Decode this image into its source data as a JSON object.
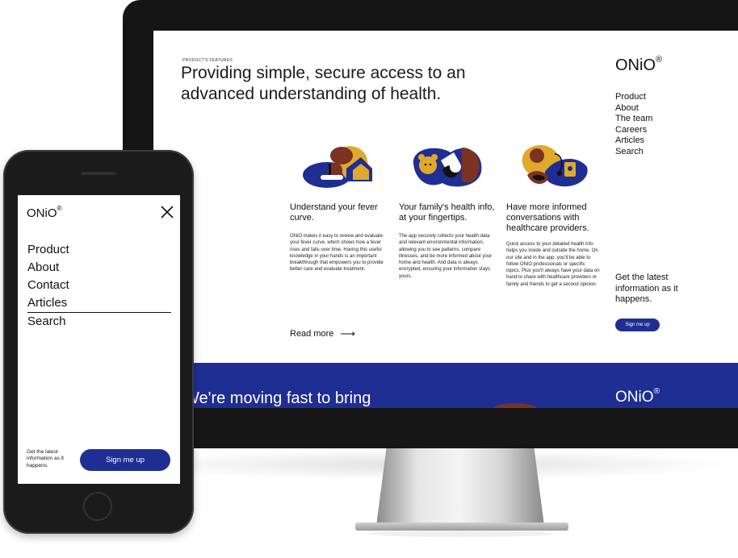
{
  "colors": {
    "brand_blue": "#1f2e93",
    "illustration_yellow": "#e0a92c",
    "illustration_brown": "#7a3323",
    "device_frame": "#151515"
  },
  "desktop": {
    "eyebrow": "PRODUCT'S FEATURES",
    "hero_title": "Providing simple, secure access to an advanced understanding of health.",
    "features": [
      {
        "title": "Understand your fever curve.",
        "body": "ONiO makes it easy to review and evaluate your fever curve, which shows how a fever rises and falls over time. Having this useful knowledge in your hands is an important breakthrough that empowers you to provide better care and evaluate treatment.",
        "illustration_icon": "child-with-thermometer-illustration"
      },
      {
        "title": "Your family's health info, at your fingertips.",
        "body": "The app securely collects your health data and relevant environmental information, allowing you to see patterns, compare illnesses, and be more informed about your home and health. And data is always encrypted, ensuring your information stays yours.",
        "illustration_icon": "family-with-teddy-bear-illustration"
      },
      {
        "title": "Have more informed conversations with healthcare providers.",
        "body": "Quick access to your detailed health info helps you inside and outside the home. On our site and in the app, you'll be able to follow ONiO professionals or specific topics. Plus you'll always have your data on hand to share with healthcare providers or family and friends to get a second opinion.",
        "illustration_icon": "doctor-with-stethoscope-illustration"
      }
    ],
    "read_more": "Read more",
    "read_more_arrow": "⟶",
    "logo_text": "ONiO",
    "logo_mark": "®",
    "nav": [
      "Product",
      "About",
      "The team",
      "Careers",
      "Articles",
      "Search"
    ],
    "cta_text": "Get the latest information as it happens.",
    "cta_button": "Sign me up",
    "band_text": "We're moving fast to bring",
    "band_logo_text": "ONiO",
    "band_logo_mark": "®"
  },
  "mobile": {
    "logo_text": "ONiO",
    "logo_mark": "®",
    "close_icon": "close-icon",
    "nav": [
      "Product",
      "About",
      "Contact",
      "Articles",
      "Search"
    ],
    "active_nav_index": 3,
    "cta_text": "Get the latest information as it happens.",
    "cta_button": "Sign me up"
  }
}
